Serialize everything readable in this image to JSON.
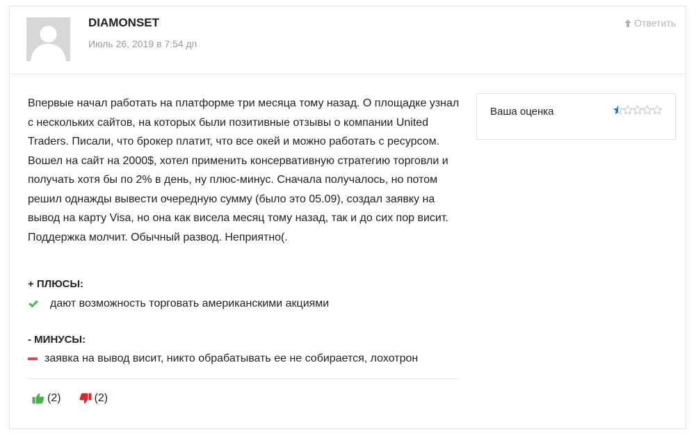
{
  "review": {
    "author": "DIAMONSET",
    "date": "Июль 26, 2019 в 7:54 дп",
    "reply_label": "Ответить",
    "text": "Впервые начал работать на платформе три месяца тому назад. О площадке узнал с нескольких сайтов, на которых были позитивные отзывы о компании United Traders. Писали, что брокер платит, что все окей и можно работать с ресурсом. Вошел на сайт на 2000$, хотел применить консервативную стратегию торговли и получать хотя бы по 2% в день, ну плюс-минус. Сначала получалось, но потом решил однажды вывести очередную сумму (было это 05.09), создал заявку на вывод на карту Visa, но она как висела месяц тому назад, так и до сих пор висит. Поддержка молчит. Обычный развод. Неприятно(.",
    "pros_title": "+ ПЛЮСЫ:",
    "pros": [
      "дают возможность торговать американскими акциями"
    ],
    "cons_title": "- МИНУСЫ:",
    "cons": [
      "заявка на вывод висит, никто обрабатывать ее не собирается, лохотрон"
    ],
    "likes": "(2)",
    "dislikes": "(2)"
  },
  "rating": {
    "label": "Ваша оценка",
    "value": 0.5,
    "max": 5
  },
  "colors": {
    "check_green": "#5cb85c",
    "minus_red": "#e0474c",
    "thumb_up": "#4cae4c",
    "thumb_down": "#d9262c",
    "star": "#1e73be",
    "muted": "#b4b4b4"
  },
  "icons": {
    "avatar": "default-avatar-icon",
    "reply": "arrow-up-icon",
    "pro": "check-icon",
    "con": "minus-icon",
    "like": "thumbs-up-icon",
    "dislike": "thumbs-down-icon",
    "star": "star-icon"
  }
}
